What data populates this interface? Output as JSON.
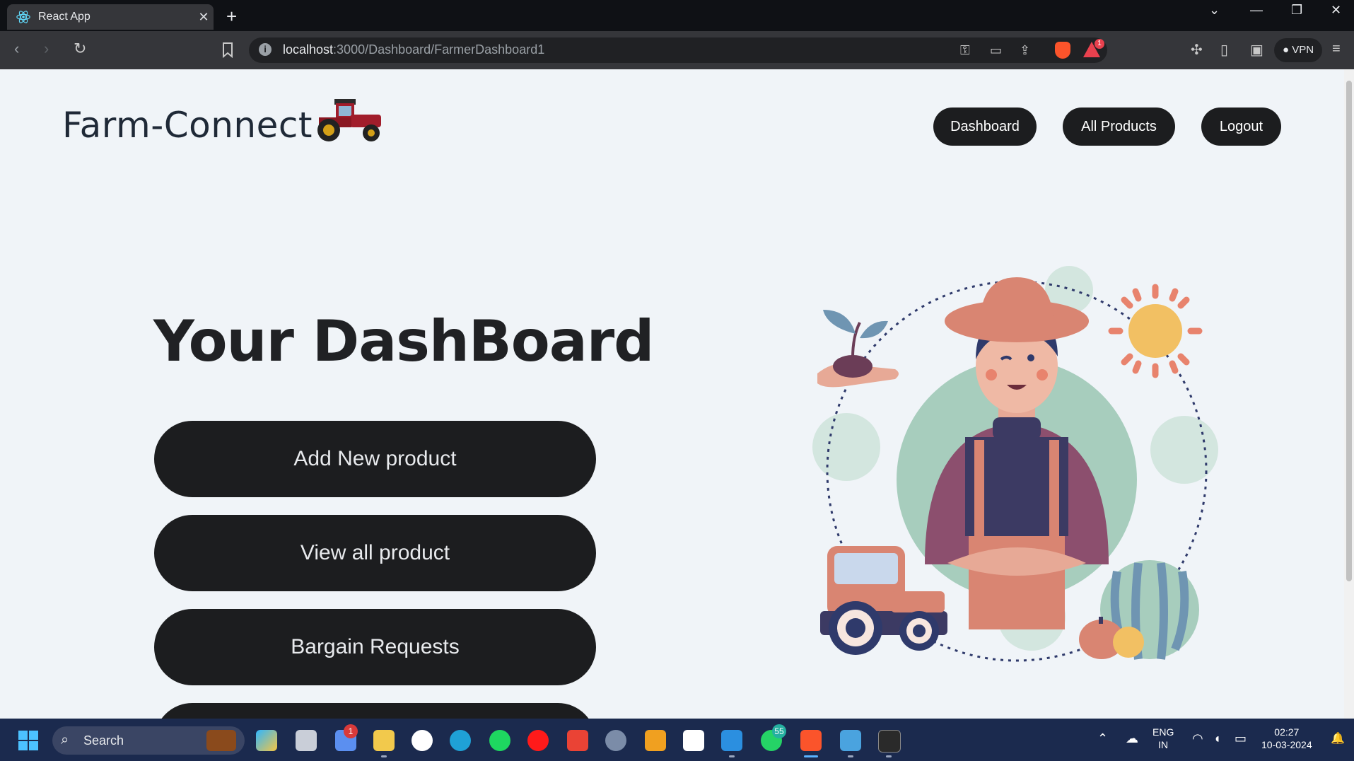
{
  "browser": {
    "tab_title": "React App",
    "new_tab": "+",
    "url_host": "localhost",
    "url_rest": ":3000/Dashboard/FarmerDashboard1",
    "vpn_label": "VPN",
    "notif_count": "1"
  },
  "header": {
    "brand": "Farm-Connect",
    "nav": [
      {
        "label": "Dashboard"
      },
      {
        "label": "All Products"
      },
      {
        "label": "Logout"
      }
    ]
  },
  "main": {
    "title": "Your DashBoard",
    "actions": [
      {
        "label": "Add New product"
      },
      {
        "label": "View all product"
      },
      {
        "label": "Bargain Requests"
      },
      {
        "label": ""
      }
    ]
  },
  "taskbar": {
    "search_label": "Search",
    "lang_line1": "ENG",
    "lang_line2": "IN",
    "time": "02:27",
    "date": "10-03-2024",
    "badge_thermo": "1",
    "badge_whatsapp": "55"
  },
  "colors": {
    "page_bg": "#f0f4f8",
    "button_bg": "#1c1d1f",
    "taskbar_bg": "#1b2a4e"
  }
}
